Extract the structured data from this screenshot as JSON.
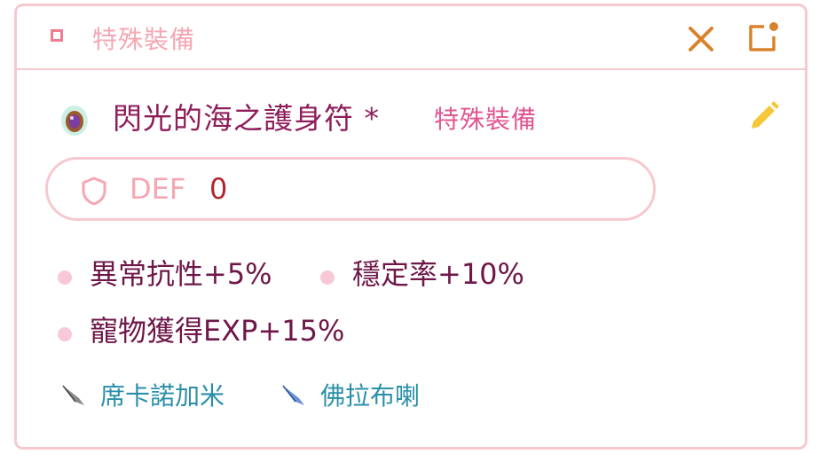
{
  "header": {
    "title": "特殊裝備"
  },
  "item": {
    "name": "閃光的海之護身符 *",
    "category": "特殊裝備"
  },
  "stat": {
    "label": "DEF",
    "value": "0"
  },
  "effects": [
    "異常抗性+5%",
    "穩定率+10%",
    "寵物獲得EXP+15%"
  ],
  "pets": [
    "席卡諾加米",
    "佛拉布喇"
  ],
  "colors": {
    "accent_pink": "#f4a7b2",
    "border_pink": "#f6c9cf",
    "name_purple": "#8e1d5a",
    "category_pink": "#e15590",
    "close_orange": "#d9822b",
    "edit_yellow": "#f5c83a",
    "value_red": "#b0282e",
    "pet_teal": "#2a8fa8"
  },
  "icons": {
    "header": "square-icon",
    "close": "close-icon",
    "popout": "open-in-new-icon",
    "item": "amulet-icon",
    "edit": "pencil-icon",
    "stat": "shield-icon",
    "pet1": "feather-grey-icon",
    "pet2": "feather-blue-icon"
  }
}
